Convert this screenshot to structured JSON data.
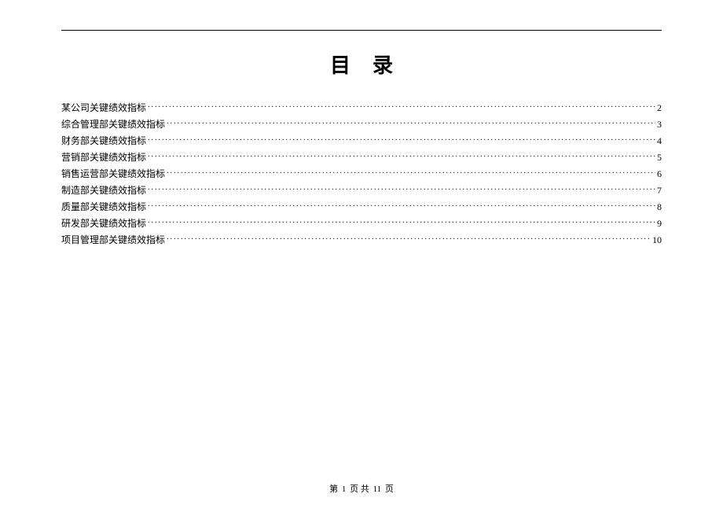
{
  "title": "目录",
  "toc": [
    {
      "label": "某公司关键绩效指标",
      "page": "2"
    },
    {
      "label": "综合管理部关键绩效指标",
      "page": "3"
    },
    {
      "label": "财务部关键绩效指标",
      "page": "4"
    },
    {
      "label": "营销部关键绩效指标",
      "page": "5"
    },
    {
      "label": "销售运营部关键绩效指标",
      "page": "6"
    },
    {
      "label": "制造部关键绩效指标",
      "page": "7"
    },
    {
      "label": "质量部关键绩效指标",
      "page": "8"
    },
    {
      "label": "研发部关键绩效指标",
      "page": "9"
    },
    {
      "label": "项目管理部关键绩效指标",
      "page": "10"
    }
  ],
  "footer": {
    "prefix": "第",
    "current": "1",
    "mid": "页 共",
    "total": "11",
    "suffix": "页"
  }
}
